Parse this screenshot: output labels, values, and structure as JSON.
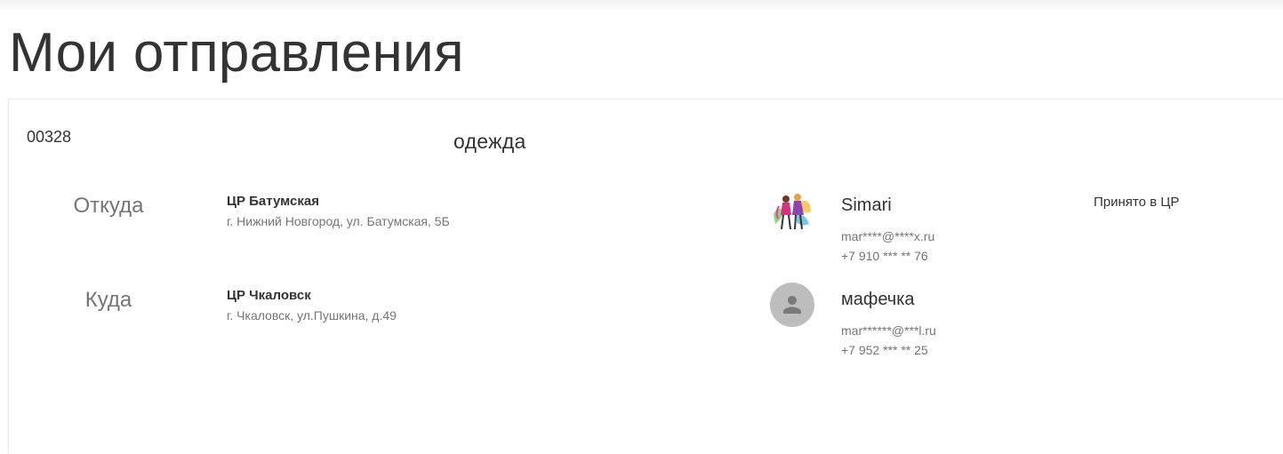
{
  "page": {
    "title": "Мои отправления"
  },
  "shipment": {
    "id": "00328",
    "description": "одежда",
    "status": "Принято в ЦР",
    "from": {
      "label": "Откуда",
      "name": "ЦР Батумская",
      "address": "г. Нижний Новгород, ул. Батумская, 5Б"
    },
    "to": {
      "label": "Куда",
      "name": "ЦР Чкаловск",
      "address": "г. Чкаловск, ул.Пушкина, д.49"
    },
    "sender": {
      "name": "Simari",
      "email": "mar****@****x.ru",
      "phone": "+7 910 *** ** 76",
      "avatar_icon": "fashion-illustration-avatar"
    },
    "recipient": {
      "name": "мафечка",
      "email": "mar******@***l.ru",
      "phone": "+7 952 *** ** 25",
      "avatar_icon": "default-person-icon"
    }
  }
}
